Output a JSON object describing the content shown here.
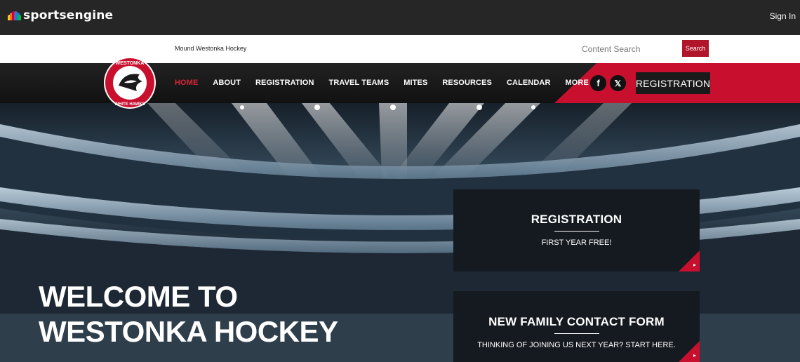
{
  "topbar": {
    "brand": "sportsengine",
    "sign_in": "Sign In",
    "peacock_colors": [
      "#fccc12",
      "#f37021",
      "#cc004c",
      "#6460aa",
      "#0089d0",
      "#0db14b"
    ]
  },
  "site": {
    "name": "Mound Westonka Hockey",
    "search_placeholder": "Content Search",
    "search_button": "Search",
    "logo": {
      "top_text": "WESTONKA",
      "bottom_text": "WHITE HAWKS"
    }
  },
  "nav": {
    "items": [
      {
        "label": "HOME",
        "active": true
      },
      {
        "label": "ABOUT",
        "active": false
      },
      {
        "label": "REGISTRATION",
        "active": false
      },
      {
        "label": "TRAVEL TEAMS",
        "active": false
      },
      {
        "label": "MITES",
        "active": false
      },
      {
        "label": "RESOURCES",
        "active": false
      },
      {
        "label": "CALENDAR",
        "active": false
      },
      {
        "label": "MORE +",
        "active": false
      }
    ],
    "social": [
      {
        "icon": "facebook-icon",
        "glyph": "f"
      },
      {
        "icon": "x-twitter-icon",
        "glyph": "𝕏"
      }
    ],
    "registration_button": "REGISTRATION"
  },
  "hero": {
    "welcome_line1": "WELCOME TO",
    "welcome_line2": "WESTONKA HOCKEY"
  },
  "cards": [
    {
      "title": "REGISTRATION",
      "subtitle": "FIRST YEAR FREE!"
    },
    {
      "title": "NEW FAMILY CONTACT FORM",
      "subtitle": "THINKING OF JOINING US NEXT YEAR? START HERE."
    }
  ],
  "colors": {
    "accent_red": "#c8102e",
    "dark": "#151a20"
  }
}
